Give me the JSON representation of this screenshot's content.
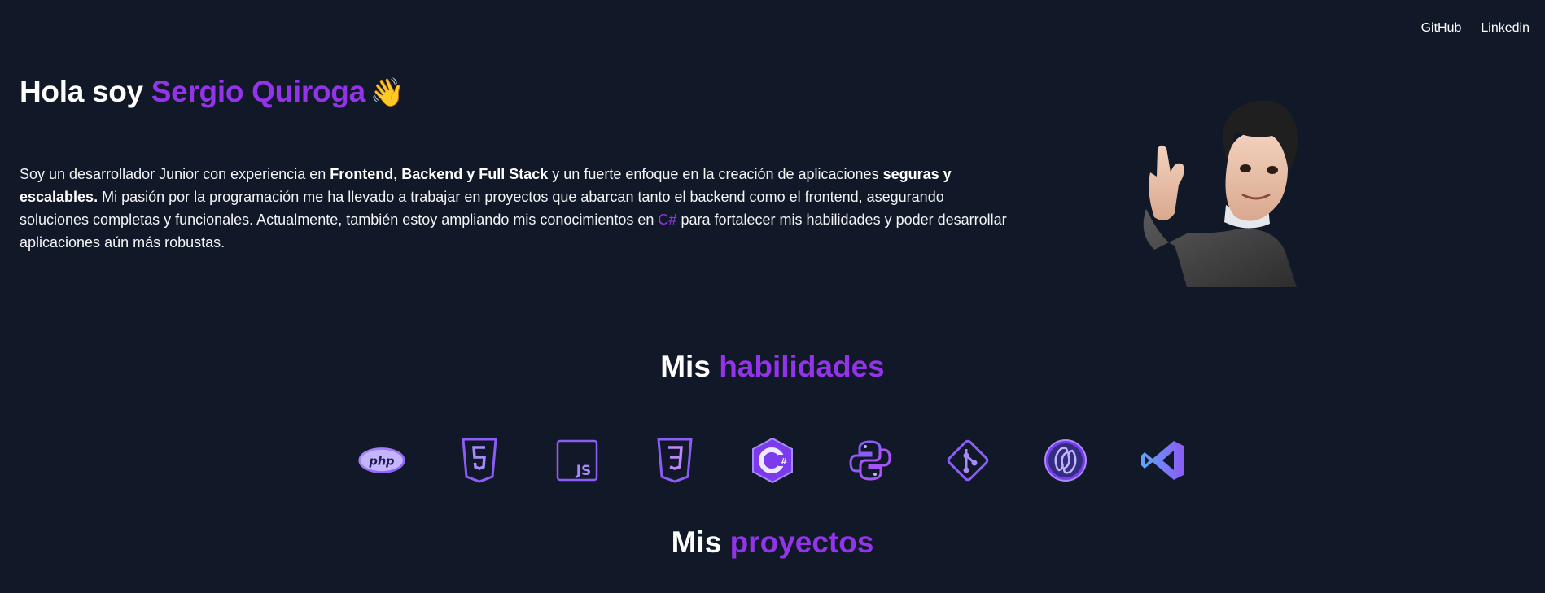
{
  "nav": {
    "github": "GitHub",
    "linkedin": "Linkedin"
  },
  "hero": {
    "greeting": "Hola soy ",
    "name": "Sergio Quiroga",
    "wave": "👋",
    "intro": {
      "p1": "Soy un desarrollador Junior con experiencia en ",
      "b1": "Frontend, Backend y Full Stack",
      "p2": " y un fuerte enfoque en la creación de aplicaciones ",
      "b2": "seguras y escalables.",
      "p3": " Mi pasión por la programación me ha llevado a trabajar en proyectos que abarcan tanto el backend como el frontend, asegurando soluciones completas y funcionales. Actualmente, también estoy ampliando mis conocimientos en ",
      "accent": "C#",
      "p4": " para fortalecer mis habilidades y poder desarrollar aplicaciones aún más robustas."
    },
    "avatar_icon": "memoji-avatar"
  },
  "skills": {
    "title_prefix": "Mis ",
    "title_accent": "habilidades",
    "icons": [
      "php-icon",
      "html5-icon",
      "javascript-icon",
      "css3-icon",
      "csharp-icon",
      "python-icon",
      "git-icon",
      "mysql-icon",
      "vscode-icon"
    ],
    "php_label": "php",
    "js_label": "JS"
  },
  "projects": {
    "title_prefix": "Mis ",
    "title_accent": "proyectos"
  },
  "colors": {
    "background": "#111827",
    "accent": "#9333ea",
    "icon_gradient_start": "#8b5cf6",
    "icon_gradient_end": "#c026d3"
  }
}
